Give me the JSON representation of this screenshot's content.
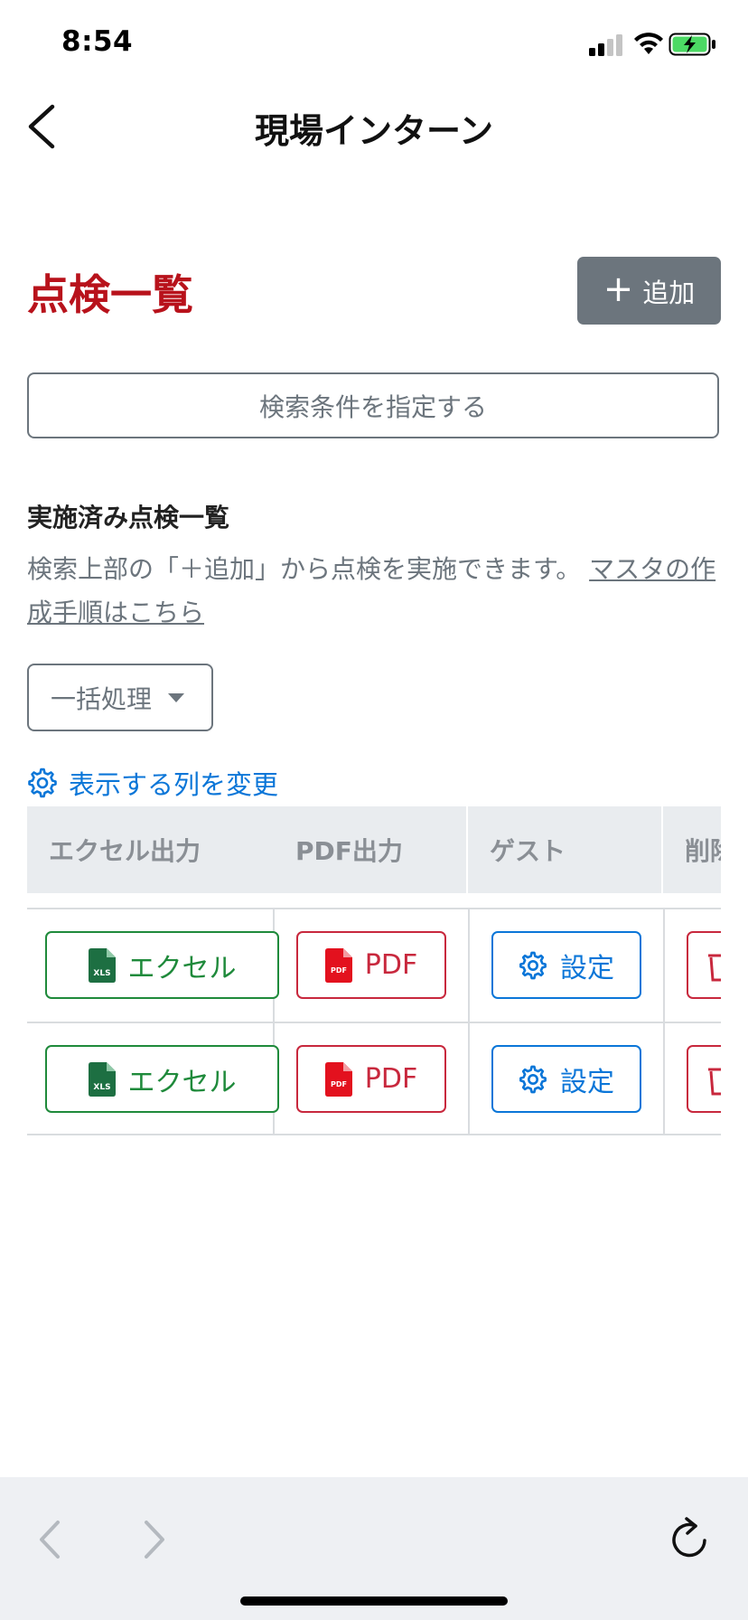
{
  "status_bar": {
    "time": "8:54"
  },
  "nav": {
    "title": "現場インターン"
  },
  "page": {
    "heading": "点検一覧",
    "add_button": {
      "plus": "+",
      "label": "追加"
    },
    "search_button": "検索条件を指定する",
    "section_title": "実施済み点検一覧",
    "help_text": "検索上部の「＋追加」から点検を実施できます。",
    "help_link": "マスタの作成手順はこちら",
    "bulk_dropdown": "一括処理",
    "change_columns": "表示する列を変更"
  },
  "table": {
    "headers": [
      "エクセル出力",
      "PDF出力",
      "ゲスト",
      "削除"
    ],
    "rows": [
      {
        "excel": "エクセル",
        "excel_badge": "XLS",
        "pdf": "PDF",
        "pdf_badge": "PDF",
        "settings": "設定"
      },
      {
        "excel": "エクセル",
        "excel_badge": "XLS",
        "pdf": "PDF",
        "pdf_badge": "PDF",
        "settings": "設定"
      }
    ]
  },
  "colors": {
    "heading_red": "#b8121b",
    "excel_green": "#1f8a3b",
    "pdf_red": "#c8283d",
    "link_blue": "#0b76d8",
    "button_gray": "#6c757d"
  },
  "icons": [
    "back-chevron-icon",
    "plus-icon",
    "gear-icon",
    "excel-file-icon",
    "pdf-file-icon",
    "trash-icon",
    "reload-icon"
  ]
}
